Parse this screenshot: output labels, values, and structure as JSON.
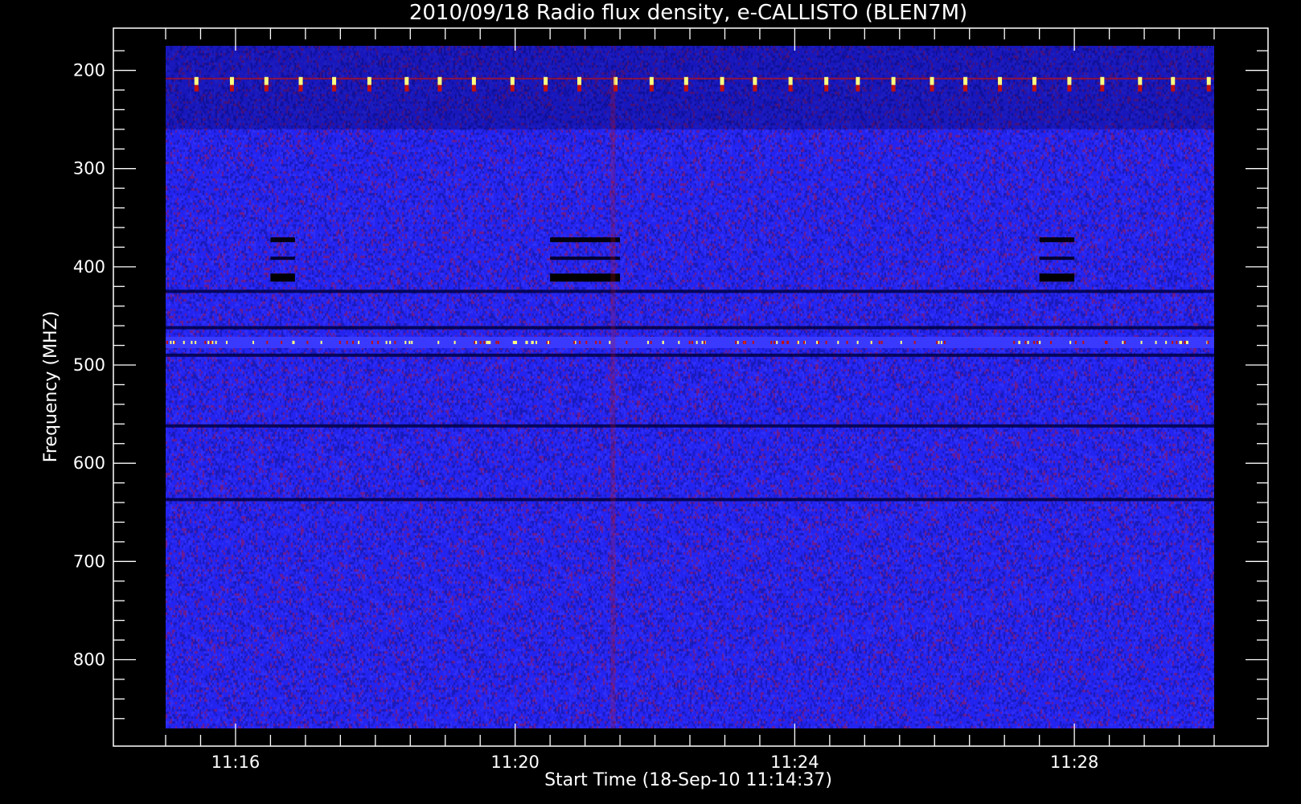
{
  "chart_data": {
    "type": "heatmap",
    "title": "2010/09/18  Radio flux density, e-CALLISTO (BLEN7M)",
    "xlabel": "Start Time (18-Sep-10 11:14:37)",
    "ylabel": "Frequency (MHZ)",
    "x_range_minutes_after_11_00": [
      15.0,
      30.0
    ],
    "y_range_mhz": [
      175,
      870
    ],
    "y_inverted": true,
    "x_ticks": [
      {
        "label": "11:16",
        "value_minutes_after_11_00": 16
      },
      {
        "label": "11:20",
        "value_minutes_after_11_00": 20
      },
      {
        "label": "11:24",
        "value_minutes_after_11_00": 24
      },
      {
        "label": "11:28",
        "value_minutes_after_11_00": 28
      }
    ],
    "y_ticks": [
      {
        "label": "200",
        "value": 200
      },
      {
        "label": "300",
        "value": 300
      },
      {
        "label": "400",
        "value": 400
      },
      {
        "label": "500",
        "value": 500
      },
      {
        "label": "600",
        "value": 600
      },
      {
        "label": "700",
        "value": 700
      },
      {
        "label": "800",
        "value": 800
      }
    ],
    "colormap": {
      "background": "#000000",
      "low": "#000044",
      "mid": "#2020ff",
      "high": "#c01010",
      "peak": "#ffff80"
    },
    "features": [
      {
        "kind": "interference_band",
        "freq_mhz": 210,
        "note": "periodic bright bursts"
      },
      {
        "kind": "dark_band",
        "freq_mhz": 425
      },
      {
        "kind": "dark_band",
        "freq_mhz": 462
      },
      {
        "kind": "bright_band",
        "freq_mhz": 477
      },
      {
        "kind": "dark_band",
        "freq_mhz": 490
      },
      {
        "kind": "dark_band",
        "freq_mhz": 562
      },
      {
        "kind": "dark_band",
        "freq_mhz": 637
      },
      {
        "kind": "black_block",
        "t_start_min": 16.5,
        "t_end_min": 16.85,
        "f_start_mhz": 370,
        "f_end_mhz": 420
      },
      {
        "kind": "black_block",
        "t_start_min": 20.5,
        "t_end_min": 21.5,
        "f_start_mhz": 370,
        "f_end_mhz": 420
      },
      {
        "kind": "black_block",
        "t_start_min": 27.5,
        "t_end_min": 28.0,
        "f_start_mhz": 370,
        "f_end_mhz": 420
      },
      {
        "kind": "vertical_streak",
        "t_min": 21.4,
        "f_start_mhz": 200,
        "f_end_mhz": 870
      }
    ]
  }
}
